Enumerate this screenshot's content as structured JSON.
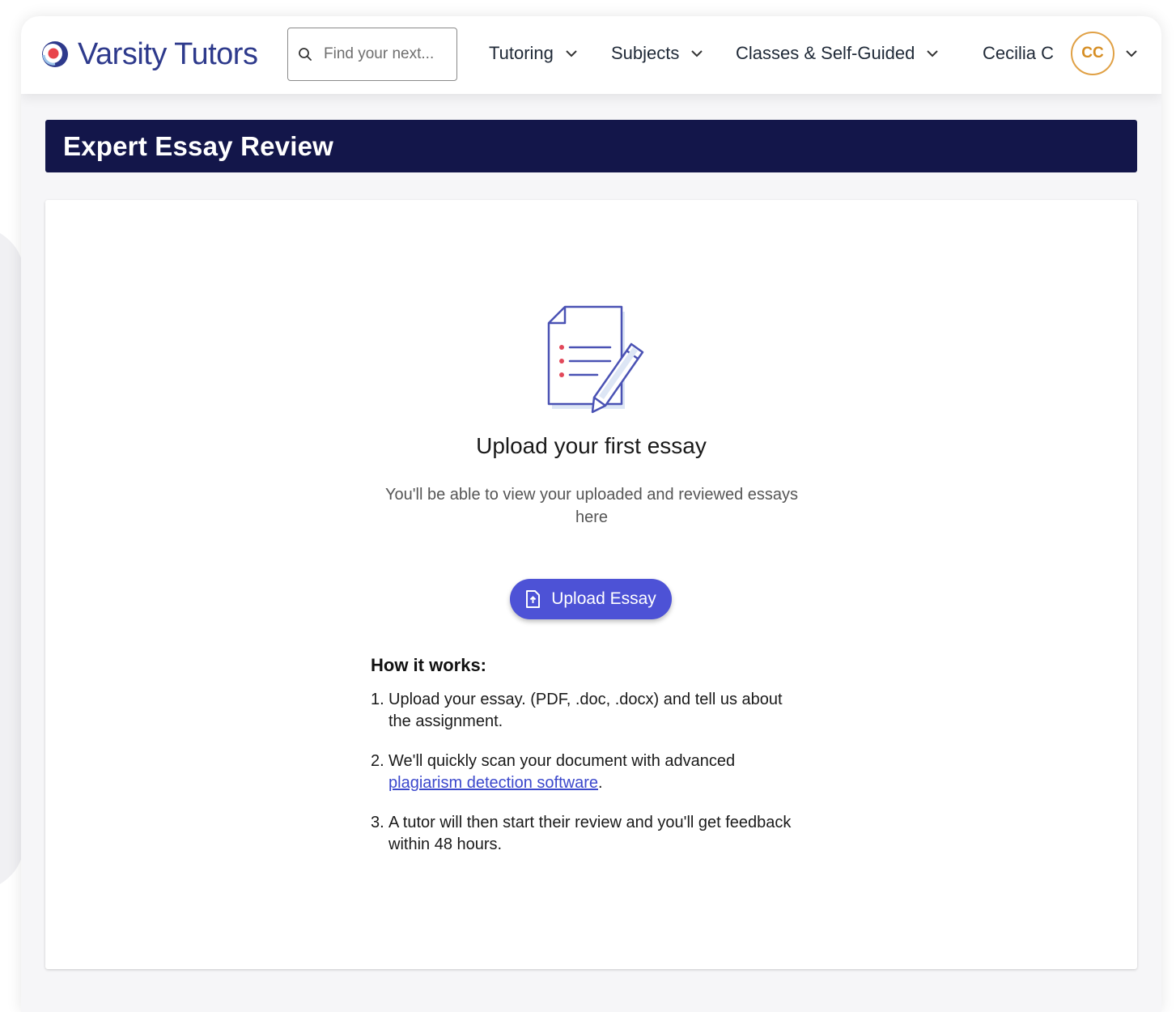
{
  "header": {
    "logo_text": "Varsity Tutors",
    "search_placeholder": "Find your next...",
    "nav": [
      {
        "label": "Tutoring"
      },
      {
        "label": "Subjects"
      },
      {
        "label": "Classes & Self-Guided"
      }
    ],
    "user_name": "Cecilia C",
    "avatar_initials": "CC"
  },
  "page": {
    "title": "Expert Essay Review"
  },
  "empty_state": {
    "headline": "Upload your first essay",
    "subtext": "You'll be able to view your uploaded and reviewed essays here",
    "upload_button": "Upload Essay",
    "illustration_icon": "essay-document-pencil-icon"
  },
  "how_it_works": {
    "heading": "How it works:",
    "steps": [
      {
        "num": "1.",
        "text": "Upload your essay. (PDF, .doc, .docx) and tell us about the assignment."
      },
      {
        "num": "2.",
        "text_before": "We'll quickly scan your document with advanced ",
        "link": "plagiarism detection software",
        "text_after": "."
      },
      {
        "num": "3.",
        "text": "A tutor will then start their review and you'll get feedback within 48 hours."
      }
    ]
  },
  "colors": {
    "brand_navy": "#13164a",
    "button_blue": "#4d52d6",
    "logo_blue": "#2e3a8c",
    "avatar_orange": "#d68e24",
    "link_blue": "#3b48cc"
  }
}
